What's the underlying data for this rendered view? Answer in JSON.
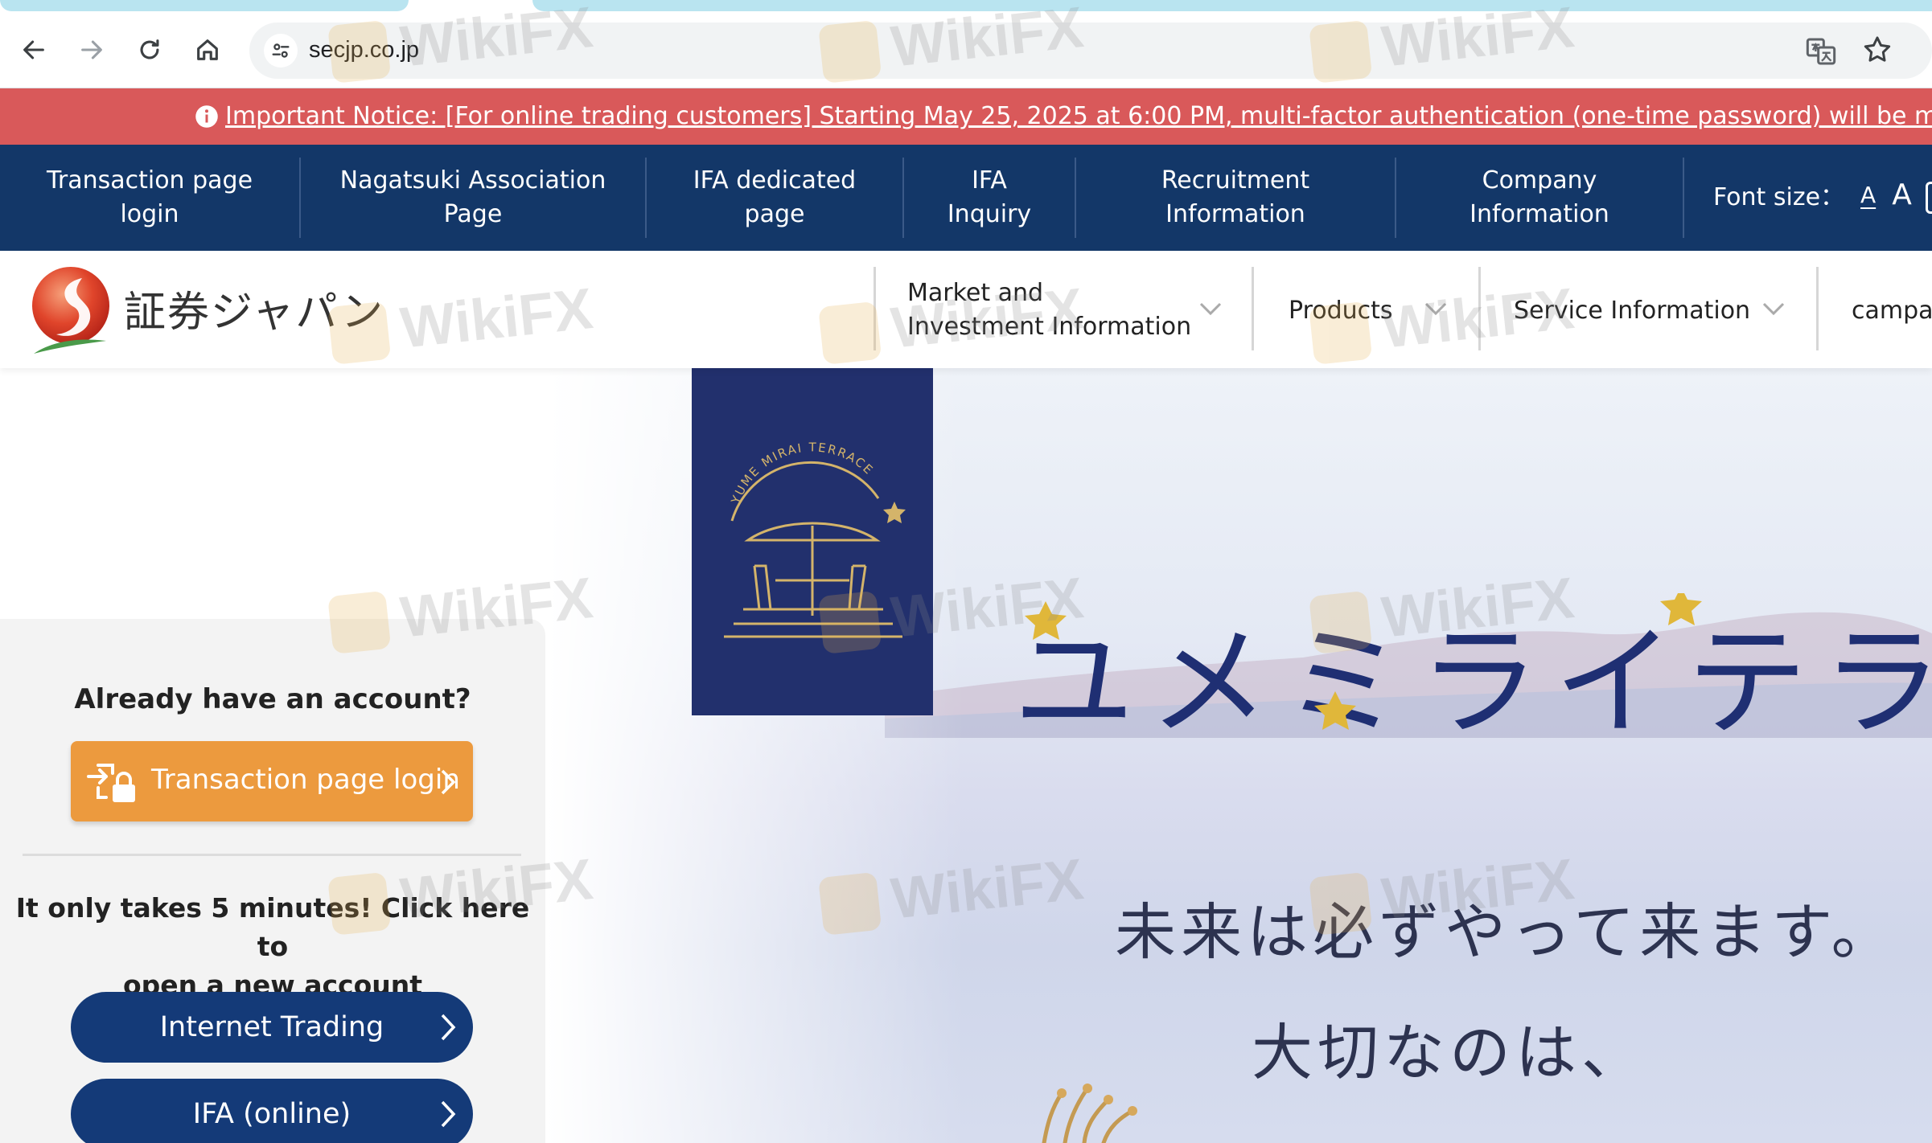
{
  "browser": {
    "url": "secjp.co.jp"
  },
  "notice": {
    "text": "Important Notice: [For online trading customers] Starting May 25, 2025 at 6:00 PM, multi-factor authentication (one-time password) will be mandatory whe"
  },
  "utility_nav": {
    "items": [
      {
        "line1": "Transaction page",
        "line2": "login"
      },
      {
        "line1": "Nagatsuki Association",
        "line2": "Page"
      },
      {
        "line1": "IFA dedicated",
        "line2": "page"
      },
      {
        "line1": "IFA",
        "line2": "Inquiry"
      },
      {
        "line1": "Recruitment",
        "line2": "Information"
      },
      {
        "line1": "Company",
        "line2": "Information"
      }
    ],
    "font_size_label": "Font size：",
    "font_small": "A",
    "font_large": "A"
  },
  "brand": {
    "name": "証券ジャパン"
  },
  "main_nav": {
    "items": [
      {
        "line1": "Market and",
        "line2": "Investment Information"
      },
      {
        "line1": "Products",
        "line2": ""
      },
      {
        "line1": "Service Information",
        "line2": ""
      },
      {
        "line1": "campai",
        "line2": ""
      }
    ]
  },
  "hero": {
    "emblem_text": "YUME MIRAI TERRACE",
    "title": "ユメミライテラス",
    "line1": "未来は必ずやって来ます。",
    "line2": "大切なのは、"
  },
  "account_panel": {
    "heading": "Already have an account?",
    "login_button": "Transaction page login",
    "promo_line1": "It only takes 5 minutes! Click here to",
    "promo_line2": "open a new account",
    "buttons": [
      "Internet Trading",
      "IFA (online)"
    ]
  },
  "watermark": {
    "text": "WikiFX"
  },
  "colors": {
    "notice_bg": "#d9595a",
    "nav_bg": "#133768",
    "login_orange": "#ec9a3e",
    "button_navy": "#143a78",
    "emblem_navy": "#22306d",
    "hero_title": "#1f2f73"
  }
}
